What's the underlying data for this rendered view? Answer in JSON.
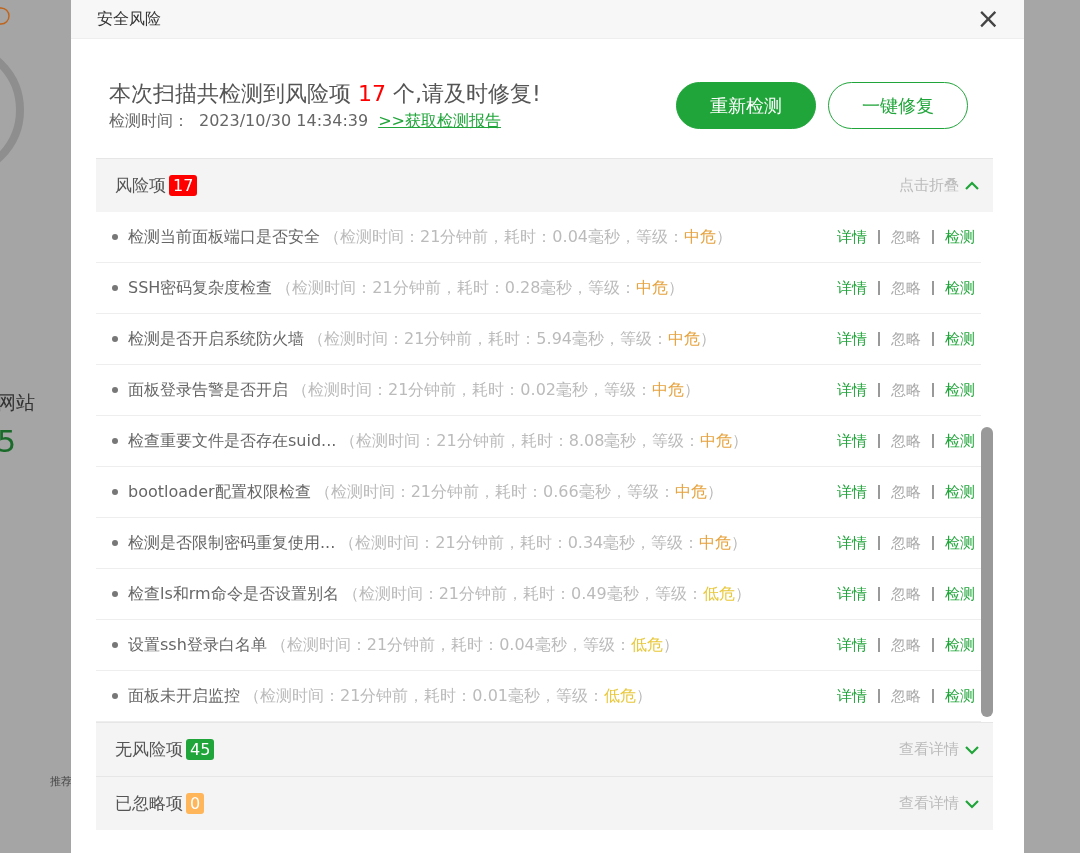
{
  "background": {
    "label": "网站",
    "count": "5",
    "note": "推荐"
  },
  "dialog": {
    "title": "安全风险",
    "close": "×"
  },
  "summary": {
    "text_before": "本次扫描共检测到风险项",
    "count": "17",
    "text_after": "个,请及时修复!",
    "time_label": "检测时间：",
    "time": "2023/10/30 14:34:39",
    "report_link": ">>获取检测报告"
  },
  "buttons": [
    {
      "label": "重新检测",
      "kind": "primary"
    },
    {
      "label": "一键修复",
      "kind": "outline"
    }
  ],
  "sections": [
    {
      "title": "风险项",
      "count": "17",
      "color": "#ff0000",
      "toggle": "点击折叠",
      "expanded": true,
      "items": [
        {
          "name": "检测当前面板端口是否安全",
          "detail": "（检测时间：21分钟前，耗时：0.04毫秒，等级：",
          "grade": "中危",
          "detail_end": "）",
          "color": "#e6a23c",
          "actions": [
            {
              "label": "详情",
              "kind": "primary"
            },
            {
              "label": "忽略",
              "kind": "muted"
            },
            {
              "label": "检测",
              "kind": "primary"
            }
          ]
        },
        {
          "name": "SSH密码复杂度检查",
          "detail": "（检测时间：21分钟前，耗时：0.28毫秒，等级：",
          "grade": "中危",
          "detail_end": "）",
          "color": "#e6a23c",
          "actions": [
            {
              "label": "详情",
              "kind": "primary"
            },
            {
              "label": "忽略",
              "kind": "muted"
            },
            {
              "label": "检测",
              "kind": "primary"
            }
          ]
        },
        {
          "name": "检测是否开启系统防火墙",
          "detail": "（检测时间：21分钟前，耗时：5.94毫秒，等级：",
          "grade": "中危",
          "detail_end": "）",
          "color": "#e6a23c",
          "actions": [
            {
              "label": "详情",
              "kind": "primary"
            },
            {
              "label": "忽略",
              "kind": "muted"
            },
            {
              "label": "检测",
              "kind": "primary"
            }
          ]
        },
        {
          "name": "面板登录告警是否开启",
          "detail": "（检测时间：21分钟前，耗时：0.02毫秒，等级：",
          "grade": "中危",
          "detail_end": "）",
          "color": "#e6a23c",
          "actions": [
            {
              "label": "详情",
              "kind": "primary"
            },
            {
              "label": "忽略",
              "kind": "muted"
            },
            {
              "label": "检测",
              "kind": "primary"
            }
          ]
        },
        {
          "name": "检查重要文件是否存在suid...",
          "detail": "（检测时间：21分钟前，耗时：8.08毫秒，等级：",
          "grade": "中危",
          "detail_end": "）",
          "color": "#e6a23c",
          "actions": [
            {
              "label": "详情",
              "kind": "primary"
            },
            {
              "label": "忽略",
              "kind": "muted"
            },
            {
              "label": "检测",
              "kind": "primary"
            }
          ]
        },
        {
          "name": "bootloader配置权限检查",
          "detail": "（检测时间：21分钟前，耗时：0.66毫秒，等级：",
          "grade": "中危",
          "detail_end": "）",
          "color": "#e6a23c",
          "actions": [
            {
              "label": "详情",
              "kind": "primary"
            },
            {
              "label": "忽略",
              "kind": "muted"
            },
            {
              "label": "检测",
              "kind": "primary"
            }
          ]
        },
        {
          "name": "检测是否限制密码重复使用...",
          "detail": "（检测时间：21分钟前，耗时：0.34毫秒，等级：",
          "grade": "中危",
          "detail_end": "）",
          "color": "#e6a23c",
          "actions": [
            {
              "label": "详情",
              "kind": "primary"
            },
            {
              "label": "忽略",
              "kind": "muted"
            },
            {
              "label": "检测",
              "kind": "primary"
            }
          ]
        },
        {
          "name": "检查ls和rm命令是否设置别名",
          "detail": "（检测时间：21分钟前，耗时：0.49毫秒，等级：",
          "grade": "低危",
          "detail_end": "）",
          "color": "#e8c83a",
          "actions": [
            {
              "label": "详情",
              "kind": "primary"
            },
            {
              "label": "忽略",
              "kind": "muted"
            },
            {
              "label": "检测",
              "kind": "primary"
            }
          ]
        },
        {
          "name": "设置ssh登录白名单",
          "detail": "（检测时间：21分钟前，耗时：0.04毫秒，等级：",
          "grade": "低危",
          "detail_end": "）",
          "color": "#e8c83a",
          "actions": [
            {
              "label": "详情",
              "kind": "primary"
            },
            {
              "label": "忽略",
              "kind": "muted"
            },
            {
              "label": "检测",
              "kind": "primary"
            }
          ]
        },
        {
          "name": "面板未开启监控",
          "detail": "（检测时间：21分钟前，耗时：0.01毫秒，等级：",
          "grade": "低危",
          "detail_end": "）",
          "color": "#e8c83a",
          "actions": [
            {
              "label": "详情",
              "kind": "primary"
            },
            {
              "label": "忽略",
              "kind": "muted"
            },
            {
              "label": "检测",
              "kind": "primary"
            }
          ]
        }
      ]
    },
    {
      "title": "无风险项",
      "count": "45",
      "color": "#20a53a",
      "toggle": "查看详情",
      "expanded": false
    },
    {
      "title": "已忽略项",
      "count": "0",
      "color": "#ffb55a",
      "toggle": "查看详情",
      "expanded": false
    }
  ]
}
